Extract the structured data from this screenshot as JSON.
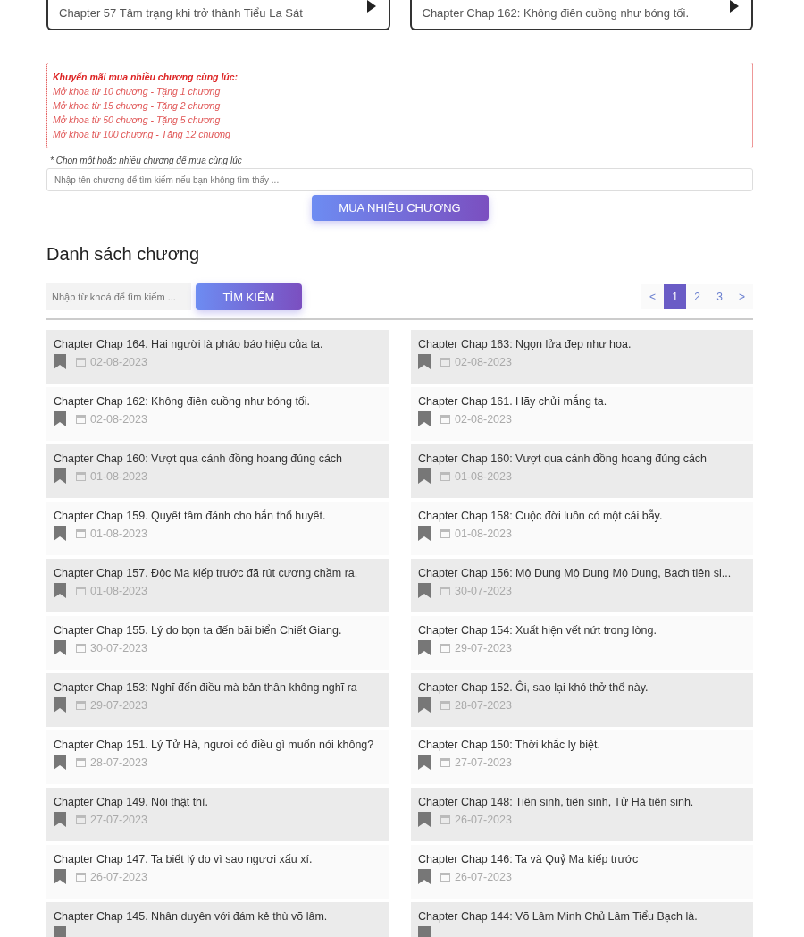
{
  "nav_cards": [
    {
      "label": "Chapter 57 Tâm trạng khi trở thành Tiểu La Sát"
    },
    {
      "label": "Chapter Chap 162: Không điên cuồng như bóng tối."
    }
  ],
  "promo": {
    "title": "Khuyến mãi mua nhiều chương cùng lúc:",
    "lines": [
      "Mở khoa từ 10 chương - Tặng 1 chương",
      "Mở khoa từ 15 chương - Tặng 2 chương",
      "Mở khoa từ 50 chương - Tặng 5 chương",
      "Mở khoa từ 100 chương - Tặng 12 chương"
    ]
  },
  "bulk": {
    "note": "* Chọn một hoặc nhiều chương để mua cùng lúc",
    "placeholder": "Nhập tên chương để tìm kiếm nếu bạn không tìm thấy ...",
    "button": "MUA NHIỀU CHƯƠNG"
  },
  "chapter_list": {
    "title": "Danh sách chương",
    "search_placeholder": "Nhập từ khoá để tìm kiếm ...",
    "search_button": "TÌM KIẾM",
    "pagination": [
      {
        "label": "<",
        "selected": false
      },
      {
        "label": "1",
        "selected": true
      },
      {
        "label": "2",
        "selected": false
      },
      {
        "label": "3",
        "selected": false
      },
      {
        "label": ">",
        "selected": false
      }
    ],
    "chapters": [
      {
        "title": "Chapter Chap 164. Hai người là pháo báo hiệu của ta.",
        "date": "02-08-2023"
      },
      {
        "title": "Chapter Chap 163: Ngọn lửa đẹp như hoa.",
        "date": "02-08-2023"
      },
      {
        "title": "Chapter Chap 162: Không điên cuồng như bóng tối.",
        "date": "02-08-2023"
      },
      {
        "title": "Chapter Chap 161. Hãy chửi mắng ta.",
        "date": "02-08-2023"
      },
      {
        "title": "Chapter Chap 160: Vượt qua cánh đồng hoang đúng cách",
        "date": "01-08-2023"
      },
      {
        "title": "Chapter Chap 160: Vượt qua cánh đồng hoang đúng cách",
        "date": "01-08-2023"
      },
      {
        "title": "Chapter Chap 159. Quyết tâm đánh cho hắn thổ huyết.",
        "date": "01-08-2023"
      },
      {
        "title": "Chapter Chap 158: Cuộc đời luôn có một cái bẫy.",
        "date": "01-08-2023"
      },
      {
        "title": "Chapter Chap 157. Độc Ma kiếp trước đã rút cương chầm ra.",
        "date": "01-08-2023"
      },
      {
        "title": "Chapter Chap 156: Mộ Dung Mộ Dung Mộ Dung, Bạch tiên si...",
        "date": "30-07-2023"
      },
      {
        "title": "Chapter Chap 155. Lý do bọn ta đến bãi biển Chiết Giang.",
        "date": "30-07-2023"
      },
      {
        "title": "Chapter Chap 154: Xuất hiện vết nứt trong lòng.",
        "date": "29-07-2023"
      },
      {
        "title": "Chapter Chap 153: Nghĩ đến điều mà bản thân không nghĩ ra",
        "date": "29-07-2023"
      },
      {
        "title": "Chapter Chap 152. Ôi, sao lại khó thở thế này.",
        "date": "28-07-2023"
      },
      {
        "title": "Chapter Chap 151. Lý Tử Hà, ngươi có điều gì muốn nói không?",
        "date": "28-07-2023"
      },
      {
        "title": "Chapter Chap 150: Thời khắc ly biệt.",
        "date": "27-07-2023"
      },
      {
        "title": "Chapter Chap 149. Nói thật thì.",
        "date": "27-07-2023"
      },
      {
        "title": "Chapter Chap 148: Tiên sinh, tiên sinh, Tử Hà tiên sinh.",
        "date": "26-07-2023"
      },
      {
        "title": "Chapter Chap 147. Ta biết lý do vì sao ngươi xấu xí.",
        "date": "26-07-2023"
      },
      {
        "title": "Chapter Chap 146: Ta và Quỷ Ma kiếp trước",
        "date": "26-07-2023"
      },
      {
        "title": "Chapter Chap 145. Nhân duyên với đám kẻ thù võ lâm."
      },
      {
        "title": "Chapter Chap 144: Võ Lâm Minh Chủ Lâm Tiểu Bạch là."
      }
    ]
  }
}
